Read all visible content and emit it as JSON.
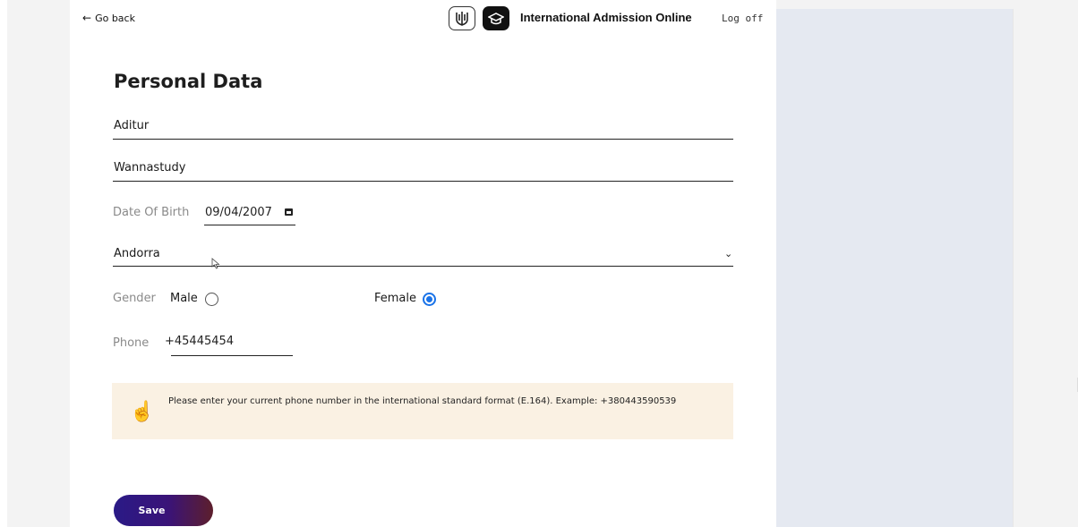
{
  "header": {
    "back_label": "Go back",
    "app_title": "International Admission Online",
    "logoff_label": "Log off"
  },
  "form": {
    "title": "Personal Data",
    "first_name": "Aditur",
    "last_name": "Wannastudy",
    "dob_label": "Date Of Birth",
    "dob_value": "09/04/2007",
    "country_value": "Andorra",
    "gender_label": "Gender",
    "gender_options": [
      {
        "label": "Male",
        "selected": false
      },
      {
        "label": "Female",
        "selected": true
      }
    ],
    "phone_label": "Phone",
    "phone_value": "+45445454",
    "notice_text": "Please enter your current phone number in the international standard format (E.164). Example: +380443590539",
    "save_label": "Save"
  },
  "icons": [
    "arrow-left-icon",
    "trident-icon",
    "graduation-cap-icon",
    "calendar-icon",
    "chevron-down-icon",
    "pointing-hand-icon",
    "mouse-cursor-icon"
  ],
  "colors": {
    "side_panel": "#e5e9f1",
    "notice_bg": "#faf1e3",
    "radio_accent": "#1a73e8",
    "save_gradient_start": "#2a1a86",
    "save_gradient_end": "#5d1f2c"
  }
}
